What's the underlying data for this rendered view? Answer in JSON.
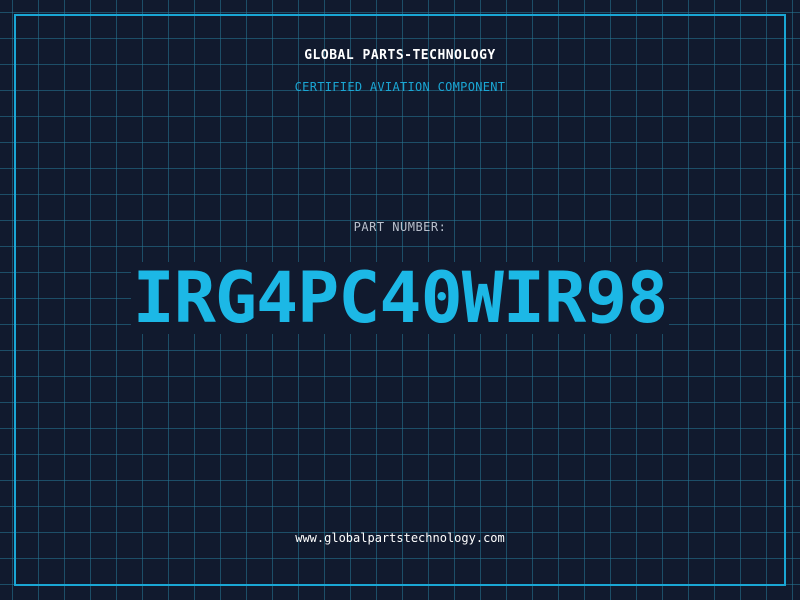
{
  "header": {
    "company": "GLOBAL PARTS-TECHNOLOGY",
    "subtitle": "CERTIFIED AVIATION COMPONENT"
  },
  "part": {
    "label": "PART NUMBER:",
    "number": "IRG4PC40WIR98"
  },
  "footer": {
    "website": "www.globalpartstechnology.com"
  },
  "colors": {
    "background": "#111a2e",
    "accent": "#1aa6d4",
    "part_number": "#1cb8e6",
    "label": "#b9c0cc",
    "text": "#ffffff"
  }
}
